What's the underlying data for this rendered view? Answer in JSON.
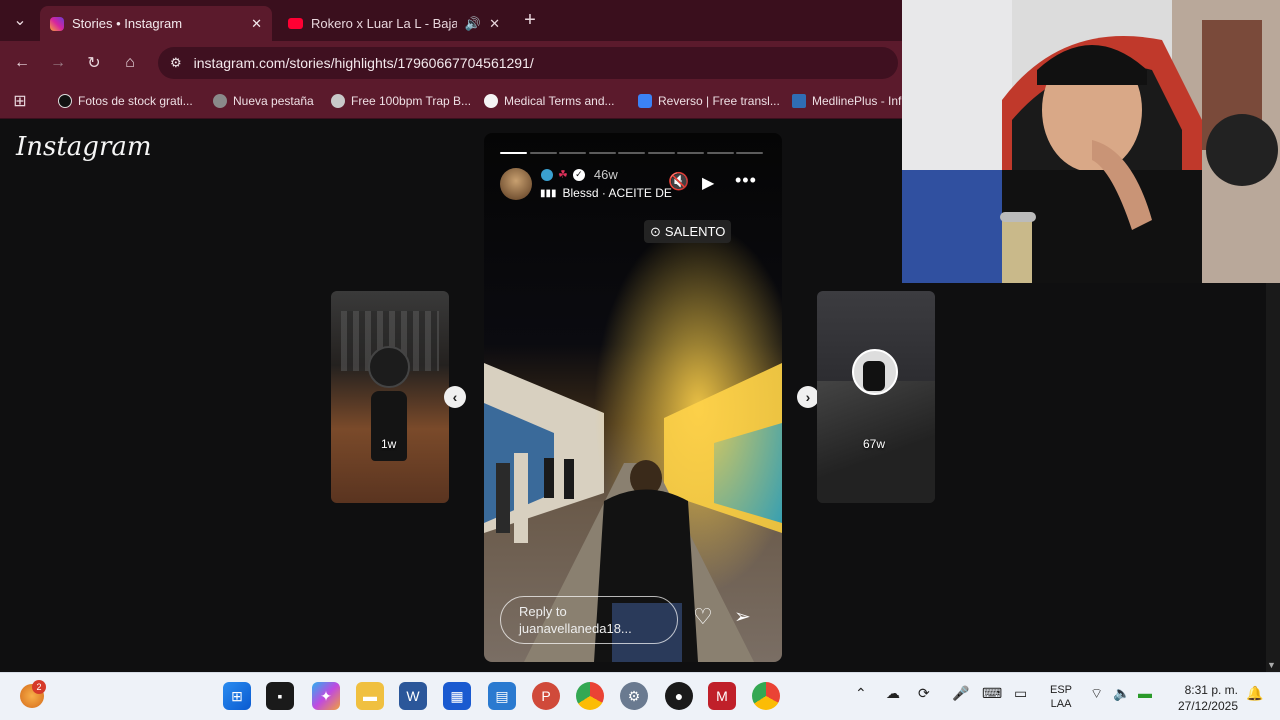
{
  "browser": {
    "tabs": [
      {
        "title": "Stories • Instagram",
        "active": true
      },
      {
        "title": "Rokero x Luar La L - Baja y S",
        "active": false
      }
    ],
    "url": "instagram.com/stories/highlights/17960667704561291/",
    "bookmarks": [
      "Fotos de stock grati...",
      "Nueva pestaña",
      "Free 100bpm Trap B...",
      "Medical Terms and...",
      "Reverso | Free transl...",
      "MedlinePlus - Inf"
    ],
    "colors": {
      "tabstrip": "#3a0f1d",
      "toolbar": "#5b1a2c"
    }
  },
  "instagram": {
    "logo": "Instagram",
    "story": {
      "time": "46w",
      "music": "Blessd · ACEITE DE",
      "location": "SALENTO",
      "reply_placeholder": "Reply to juanavellaneda18...",
      "segments_total": 9,
      "segments_done": 1
    },
    "prev_story": {
      "time": "1w"
    },
    "next_story": {
      "time": "67w"
    }
  },
  "taskbar": {
    "lang_top": "ESP",
    "lang_bottom": "LAA",
    "time": "8:31 p. m.",
    "date": "27/12/2025",
    "notification_count": "2"
  }
}
